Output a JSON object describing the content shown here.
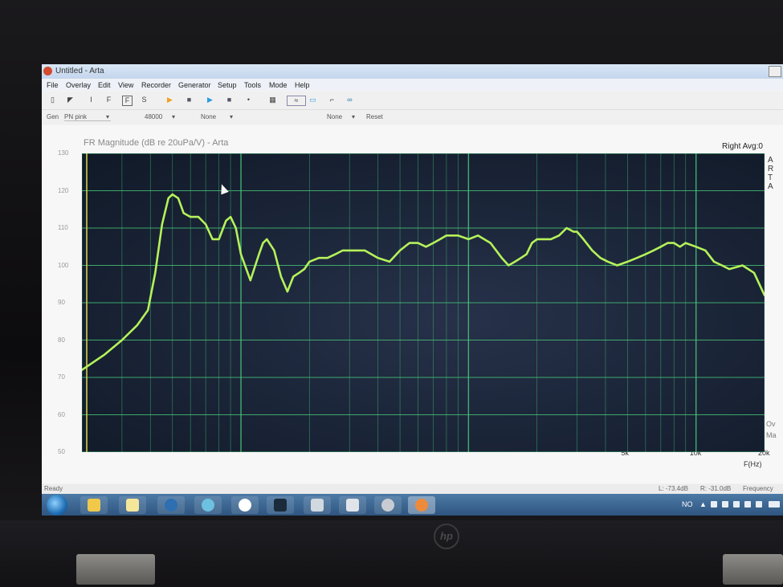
{
  "window": {
    "title": "Untitled - Arta"
  },
  "menu": [
    "File",
    "Overlay",
    "Edit",
    "View",
    "Recorder",
    "Generator",
    "Setup",
    "Tools",
    "Mode",
    "Help"
  ],
  "genbar": {
    "gen_label": "Gen",
    "gen_value": "PN pink",
    "rate": "48000",
    "level": "None",
    "reset": "Reset"
  },
  "plot": {
    "title": "FR Magnitude (dB re 20uPa/V) - Arta",
    "right_label": "Right  Avg:0",
    "arta_letters": [
      "A",
      "R",
      "T",
      "A"
    ],
    "legend_overlay": "Ov",
    "legend_magnitude": "Ma",
    "xlabel": "F(Hz)"
  },
  "chart_data": {
    "type": "line",
    "x_scale": "log",
    "xlim": [
      20,
      20000
    ],
    "ylim": [
      50,
      130
    ],
    "y_ticks": [
      50,
      60,
      70,
      80,
      90,
      100,
      110,
      120,
      130
    ],
    "x_tick_labels": [
      {
        "f": 5000,
        "label": "5k"
      },
      {
        "f": 10000,
        "label": "10k"
      },
      {
        "f": 20000,
        "label": "20k"
      }
    ],
    "colors": {
      "trace": "#b5f25a",
      "grid": "#47c979",
      "cursor": "#e0d84a",
      "background": "#101a28"
    },
    "cursor_freq": 21,
    "series": [
      {
        "x": [
          20,
          25,
          30,
          35,
          39,
          42,
          45,
          48,
          50,
          53,
          56,
          60,
          65,
          70,
          75,
          80,
          86,
          90,
          95,
          100,
          110,
          120,
          125,
          130,
          140,
          150,
          160,
          170,
          180,
          190,
          200,
          220,
          240,
          260,
          280,
          300,
          350,
          400,
          450,
          500,
          550,
          600,
          650,
          700,
          750,
          800,
          900,
          1000,
          1100,
          1250,
          1400,
          1500,
          1600,
          1700,
          1800,
          1900,
          2000,
          2300,
          2500,
          2700,
          2900,
          3000,
          3200,
          3500,
          3800,
          4100,
          4500,
          5000,
          5500,
          6000,
          6500,
          7000,
          7500,
          8000,
          8500,
          9000,
          10000,
          11000,
          12000,
          13000,
          14000,
          16000,
          18000,
          20000
        ],
        "y": [
          72,
          76,
          80,
          84,
          88,
          98,
          111,
          118,
          119,
          118,
          114,
          113,
          113,
          111,
          107,
          107,
          112,
          113,
          110,
          103,
          96,
          103,
          106,
          107,
          104,
          97,
          93,
          97,
          98,
          99,
          101,
          102,
          102,
          103,
          104,
          104,
          104,
          102,
          101,
          104,
          106,
          106,
          105,
          106,
          107,
          108,
          108,
          107,
          108,
          106,
          102,
          100,
          101,
          102,
          103,
          106,
          107,
          107,
          108,
          110,
          109,
          109,
          107,
          104,
          102,
          101,
          100,
          101,
          102,
          103,
          104,
          105,
          106,
          106,
          105,
          106,
          105,
          104,
          101,
          100,
          99,
          100,
          98,
          92
        ]
      }
    ]
  },
  "status": {
    "left": "Ready",
    "l_level": "L: -73.4dB",
    "r_level": "R: -31.0dB",
    "right": "Frequency res"
  },
  "tray": {
    "lang": "NO"
  }
}
